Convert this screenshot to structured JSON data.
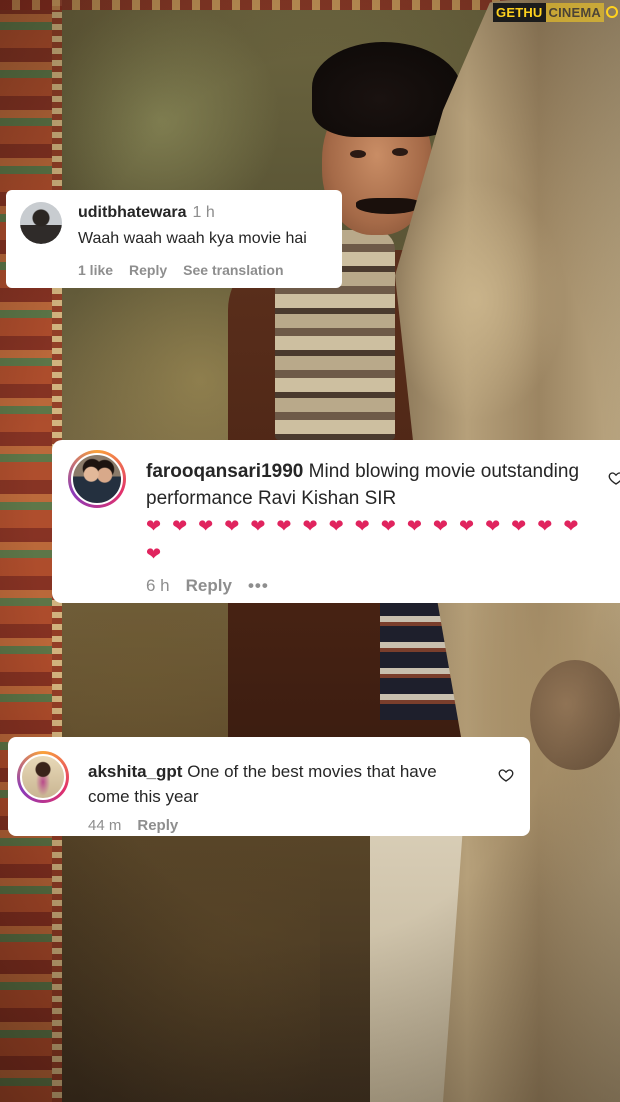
{
  "watermark": {
    "part1": "GETHU",
    "part2": "CINEMA"
  },
  "comments": [
    {
      "username": "uditbhatewara",
      "time": "1 h",
      "text": "Waah waah waah kya movie hai",
      "likes": "1 like",
      "reply_label": "Reply",
      "translate_label": "See translation"
    },
    {
      "username": "farooqansari1990",
      "text": "Mind blowing movie outstanding performance Ravi Kishan SIR",
      "hearts": "❤ ❤ ❤ ❤ ❤ ❤ ❤ ❤ ❤ ❤ ❤ ❤ ❤ ❤ ❤ ❤ ❤ ❤",
      "time": "6 h",
      "reply_label": "Reply",
      "more_label": "•••"
    },
    {
      "username": "akshita_gpt",
      "text": "One of the best movies that have come this year",
      "time": "44 m",
      "reply_label": "Reply"
    }
  ],
  "colors": {
    "card_bg": "#ffffff",
    "text": "#262626",
    "muted": "#8e8e8e",
    "heart": "#e0245e",
    "story_ring": [
      "#f9a23b",
      "#e1306c",
      "#8a3ab9"
    ]
  }
}
